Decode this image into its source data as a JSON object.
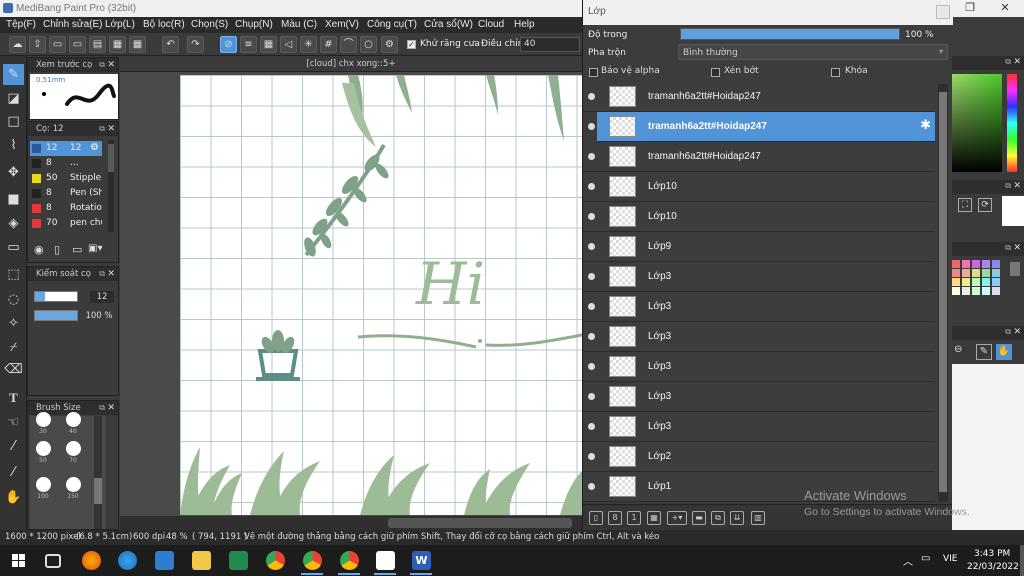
{
  "window": {
    "title": "MediBang Paint Pro (32bit)"
  },
  "menu": [
    "Tệp(F)",
    "Chỉnh sửa(E)",
    "Lớp(L)",
    "Bộ lọc(R)",
    "Chọn(S)",
    "Chụp(N)",
    "Màu (C)",
    "Xem(V)",
    "Công cụ(T)",
    "Cửa sổ(W)",
    "Cloud",
    "Help"
  ],
  "toolbar": {
    "antialias_label": "Khử răng cưa",
    "adjust_label": "Điều chỉnh",
    "adjust_value": "40"
  },
  "panels": {
    "brush_preview": {
      "title": "Xem trước cọ",
      "size_label": "0.51mm"
    },
    "brush_list": {
      "title": "Cọ: 12",
      "items": [
        {
          "size": "12",
          "name": "12",
          "color": "#2a5a9a",
          "selected": true
        },
        {
          "size": "8",
          "name": "...",
          "color": "#222222",
          "selected": false
        },
        {
          "size": "50",
          "name": "Stipple P",
          "color": "#e6d81c",
          "selected": false
        },
        {
          "size": "8",
          "name": "Pen (Sh",
          "color": "#222222",
          "selected": false
        },
        {
          "size": "8",
          "name": "Rotation",
          "color": "#e23a3a",
          "selected": false
        },
        {
          "size": "70",
          "name": "pen chu",
          "color": "#e23a3a",
          "selected": false
        }
      ]
    },
    "brush_control": {
      "title": "Kiểm soát cọ",
      "size_value": "12",
      "opacity_value": "100 %"
    },
    "brush_size": {
      "title": "Brush Size",
      "sizes": [
        "30",
        "40",
        "50",
        "70",
        "100",
        "150"
      ]
    }
  },
  "document": {
    "tab_title": "[cloud] chx xong::5+",
    "text_art": "Hi"
  },
  "layers": {
    "title": "Lớp",
    "opacity_label": "Độ trong",
    "opacity_value": "100 %",
    "opacity_fraction": 1.0,
    "blend_label": "Pha trộn",
    "blend_value": "Bình thường",
    "protect_alpha": "Bảo vệ alpha",
    "clipping": "Xén bớt",
    "lock": "Khóa",
    "items": [
      {
        "name": "tramanh6a2tt#Hoidap247",
        "selected": false
      },
      {
        "name": "tramanh6a2tt#Hoidap247",
        "selected": true
      },
      {
        "name": "tramanh6a2tt#Hoidap247",
        "selected": false
      },
      {
        "name": "Lớp10",
        "selected": false
      },
      {
        "name": "Lớp10",
        "selected": false
      },
      {
        "name": "Lớp9",
        "selected": false
      },
      {
        "name": "Lớp3",
        "selected": false
      },
      {
        "name": "Lớp3",
        "selected": false
      },
      {
        "name": "Lớp3",
        "selected": false
      },
      {
        "name": "Lớp3",
        "selected": false
      },
      {
        "name": "Lớp3",
        "selected": false
      },
      {
        "name": "Lớp3",
        "selected": false
      },
      {
        "name": "Lớp2",
        "selected": false
      },
      {
        "name": "Lớp1",
        "selected": false
      }
    ]
  },
  "status": {
    "size": "1600 * 1200 pixel",
    "physical": "(6.8 * 5.1cm)",
    "dpi": "600 dpi",
    "zoom": "48 %",
    "coords": "( 794, 1191 )",
    "hint": "Vẽ một đường thẳng bằng cách giữ phím Shift, Thay đổi cỡ cọ bằng cách giữ phím Ctrl, Alt và kéo"
  },
  "watermark": {
    "line1": "Activate Windows",
    "line2": "Go to Settings to activate Windows."
  },
  "taskbar": {
    "lang": "VIE",
    "time": "3:43 PM",
    "date": "22/03/2022"
  },
  "colors": {
    "accent": "#5294d8",
    "art_green": "#8fb08f"
  }
}
